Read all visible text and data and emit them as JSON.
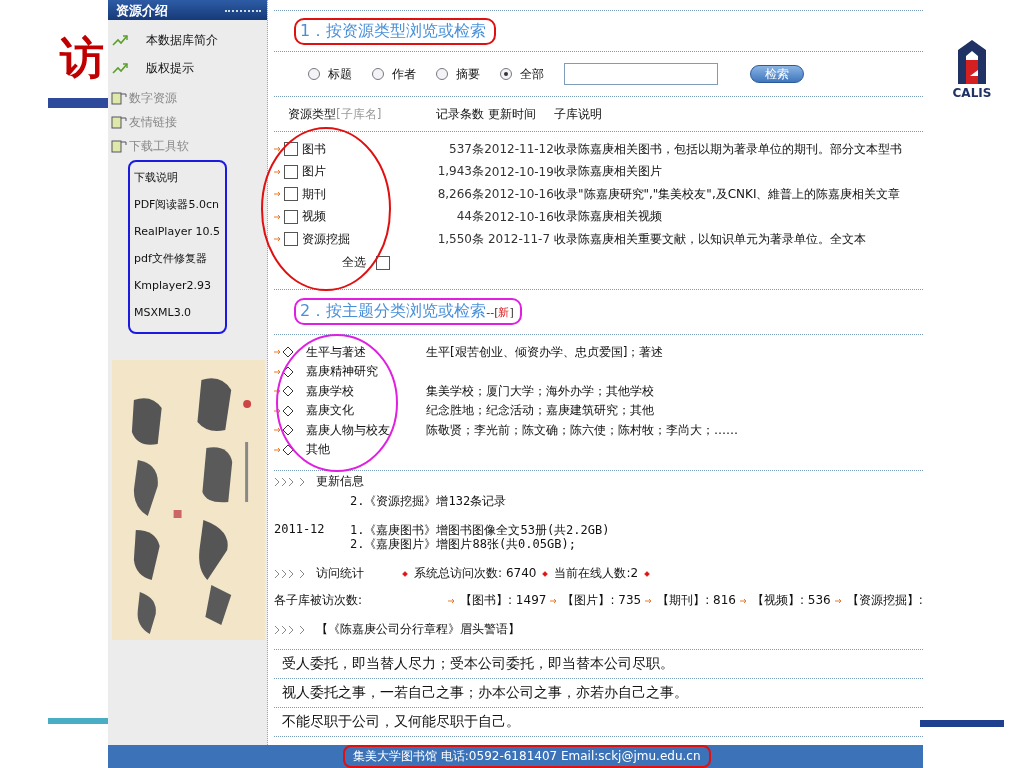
{
  "slide": {
    "title": "访",
    "logo_text": "CALIS"
  },
  "sidebar": {
    "header": "资源介绍",
    "links": [
      {
        "label": "本数据库简介"
      },
      {
        "label": "版权提示"
      }
    ],
    "sections": [
      {
        "label": "数字资源"
      },
      {
        "label": "友情链接"
      },
      {
        "label": "下载工具软"
      }
    ],
    "downloads": [
      "下载说明",
      "PDF阅读器5.0cn",
      "RealPlayer 10.5",
      "pdf文件修复器",
      "Kmplayer2.93",
      "MSXML3.0"
    ]
  },
  "section1": {
    "title": "1．按资源类型浏览或检索",
    "search_options": [
      {
        "label": "标题",
        "selected": false
      },
      {
        "label": "作者",
        "selected": false
      },
      {
        "label": "摘要",
        "selected": false
      },
      {
        "label": "全部",
        "selected": true
      }
    ],
    "search_button": "检索",
    "columns": [
      "资源类型",
      "[子库名]",
      "记录条数",
      "更新时间",
      "子库说明"
    ],
    "rows": [
      {
        "name": "图书",
        "checked": false,
        "count": "537条",
        "updated": "2012-11-12",
        "description": "收录陈嘉庚相关图书，包括以期为著录单位的期刊。部分文本型书"
      },
      {
        "name": "图片",
        "checked": false,
        "count": "1,943条",
        "updated": "2012-10-19",
        "description": "收录陈嘉庚相关图片"
      },
      {
        "name": "期刊",
        "checked": false,
        "count": "8,266条",
        "updated": "2012-10-16",
        "description": "收录\"陈嘉庚研究\",\"集美校友\",及CNKI、維普上的陈嘉庚相关文章"
      },
      {
        "name": "视频",
        "checked": false,
        "count": "44条",
        "updated": "2012-10-16",
        "description": "收录陈嘉庚相关视频"
      },
      {
        "name": "资源挖掘",
        "checked": false,
        "count": "1,550条",
        "updated": "2012-11-7",
        "description": "收录陈嘉庚相关重要文献，以知识单元为著录单位。全文本"
      }
    ],
    "select_all": {
      "label": "全选",
      "checked": false
    }
  },
  "section2": {
    "title": "2．按主题分类浏览或检索",
    "suffix_open": "--[",
    "badge": "新",
    "suffix_close": "]",
    "topics": [
      {
        "name": "生平与著述",
        "subtopics": "生平[艰苦创业、倾资办学、忠贞爱国]；著述"
      },
      {
        "name": "嘉庚精神研究"
      },
      {
        "name": "嘉庚学校",
        "subtopics": "集美学校；厦门大学；海外办学；其他学校"
      },
      {
        "name": "嘉庚文化",
        "subtopics": "纪念胜地；纪念活动；嘉庚建筑研究；其他"
      },
      {
        "name": "嘉庚人物与校友",
        "subtopics": "陈敬贤；李光前；陈文确；陈六使；陈村牧；李尚大；……"
      },
      {
        "name": "其他"
      }
    ]
  },
  "updates": {
    "title": "更新信息",
    "lines": [
      {
        "text": "2.《资源挖掘》增132条记录"
      },
      {
        "date": "2011-12",
        "text": "1.《嘉庚图书》增图书图像全文53册(共2.2GB)"
      },
      {
        "text": "2.《嘉庚图片》增图片88张(共0.05GB);"
      }
    ]
  },
  "stats": {
    "title": "访问统计",
    "total_label": "系统总访问次数:",
    "total": "6740",
    "online_label": "当前在线人数:",
    "online": "2",
    "per_library_label": "各子库被访次数:",
    "per_library": [
      {
        "name": "【图书】",
        "count": ": 1497"
      },
      {
        "name": "【图片】",
        "count": ": 735"
      },
      {
        "name": "【期刊】",
        "count": ": 816"
      },
      {
        "name": "【视频】",
        "count": ": 536"
      },
      {
        "name": "【资源挖掘】",
        "count": ":"
      }
    ]
  },
  "motto": {
    "title": "【《陈嘉庚公司分行章程》眉头警语】",
    "lines": [
      "受人委托，即当替人尽力；受本公司委托，即当替本公司尽职。",
      "视人委托之事，一若自己之事；办本公司之事，亦若办自己之事。",
      "不能尽职于公司，又何能尽职于自己。"
    ]
  },
  "footer": "集美大学图书馆  电话:0592-6181407 Email:sckj@jmu.edu.cn"
}
